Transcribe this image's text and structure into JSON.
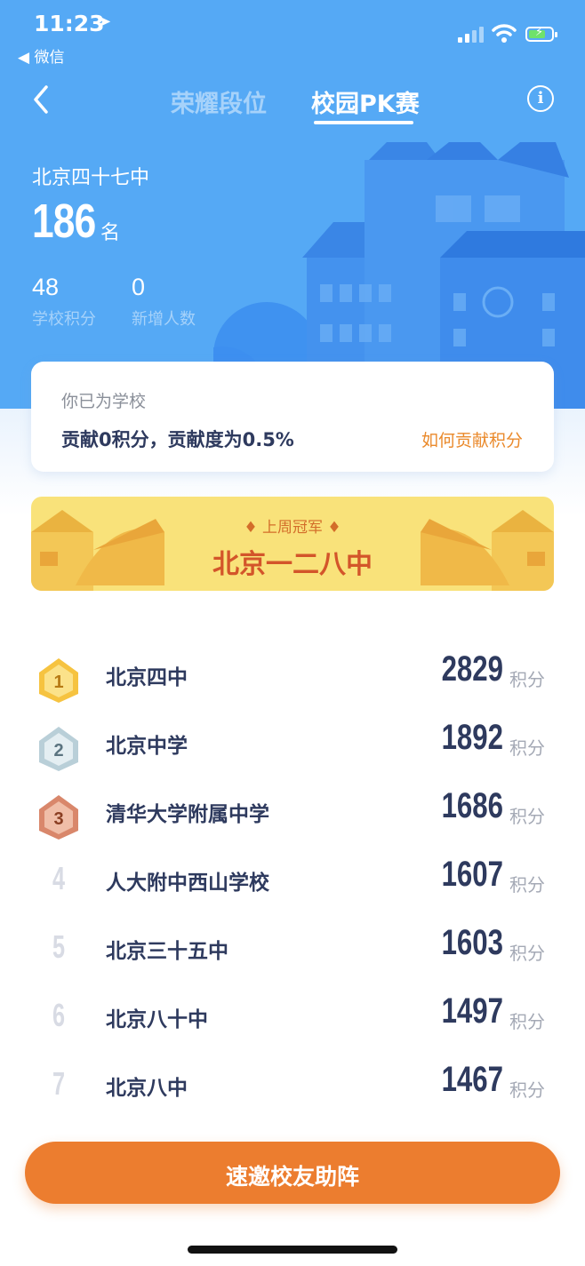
{
  "status_bar": {
    "time": "11:23",
    "back_app": "◀ 微信"
  },
  "nav": {
    "tabs": [
      {
        "label": "荣耀段位",
        "active": false
      },
      {
        "label": "校园PK赛",
        "active": true
      }
    ],
    "info_icon": "i"
  },
  "school": {
    "name": "北京四十七中",
    "rank": "186",
    "rank_unit": "名",
    "stats": [
      {
        "value": "48",
        "label": "学校积分"
      },
      {
        "value": "0",
        "label": "新增人数"
      }
    ]
  },
  "contribution": {
    "title": "你已为学校",
    "text": "贡献0积分，贡献度为0.5%",
    "link": "如何贡献积分"
  },
  "champion": {
    "label": "♦ 上周冠军 ♦",
    "name": "北京一二八中"
  },
  "ranking": [
    {
      "rank": "1",
      "name": "北京四中",
      "score": "2829",
      "unit": "积分"
    },
    {
      "rank": "2",
      "name": "北京中学",
      "score": "1892",
      "unit": "积分"
    },
    {
      "rank": "3",
      "name": "清华大学附属中学",
      "score": "1686",
      "unit": "积分"
    },
    {
      "rank": "4",
      "name": "人大附中西山学校",
      "score": "1607",
      "unit": "积分"
    },
    {
      "rank": "5",
      "name": "北京三十五中",
      "score": "1603",
      "unit": "积分"
    },
    {
      "rank": "6",
      "name": "北京八十中",
      "score": "1497",
      "unit": "积分"
    },
    {
      "rank": "7",
      "name": "北京八中",
      "score": "1467",
      "unit": "积分"
    }
  ],
  "invite_button": "速邀校友助阵",
  "colors": {
    "header_bg": "#55a9f5",
    "accent_orange": "#ec7d2f",
    "text_dark": "#2e3a5e",
    "gold": "#f2c13a",
    "silver": "#b9cfd8",
    "bronze": "#d9876b"
  }
}
